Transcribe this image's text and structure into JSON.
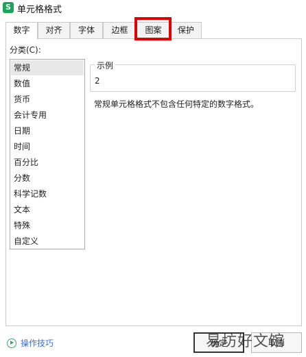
{
  "window": {
    "icon_letter": "S",
    "title": "单元格格式"
  },
  "tabs": [
    {
      "label": "数字",
      "active": true
    },
    {
      "label": "对齐",
      "active": false
    },
    {
      "label": "字体",
      "active": false
    },
    {
      "label": "边框",
      "active": false
    },
    {
      "label": "图案",
      "active": false,
      "highlighted": true
    },
    {
      "label": "保护",
      "active": false
    }
  ],
  "category": {
    "label": "分类(C):",
    "items": [
      "常规",
      "数值",
      "货币",
      "会计专用",
      "日期",
      "时间",
      "百分比",
      "分数",
      "科学记数",
      "文本",
      "特殊",
      "自定义"
    ],
    "selected": "常规"
  },
  "sample": {
    "title": "示例",
    "value": "2"
  },
  "description": "常规单元格格式不包含任何特定的数字格式。",
  "footer": {
    "tips": "操作技巧",
    "ok": "确定",
    "cancel": "取消"
  },
  "watermark": "易坊好文馆",
  "colors": {
    "highlight": "#e30000",
    "app_icon": "#1aa35a",
    "link": "#3a6fd0"
  }
}
